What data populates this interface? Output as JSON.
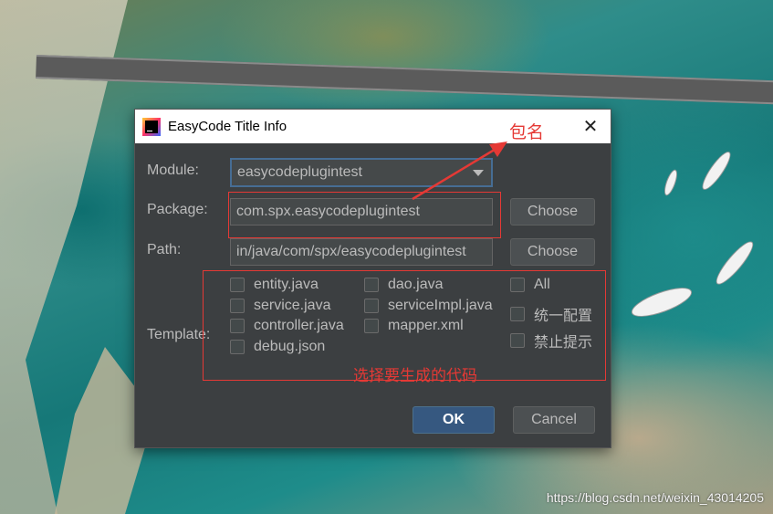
{
  "background": {
    "watermark": "https://blog.csdn.net/weixin_43014205"
  },
  "dialog": {
    "title": "EasyCode Title Info",
    "app_icon": "intellij-icon",
    "close_icon": "close-icon",
    "module": {
      "label": "Module:",
      "value": "easycodeplugintest"
    },
    "package": {
      "label": "Package:",
      "value": "com.spx.easycodeplugintest",
      "choose_label": "Choose"
    },
    "path": {
      "label": "Path:",
      "value": "in/java/com/spx/easycodeplugintest",
      "choose_label": "Choose"
    },
    "template": {
      "label": "Template:",
      "items": [
        {
          "label": "entity.java",
          "checked": false
        },
        {
          "label": "service.java",
          "checked": false
        },
        {
          "label": "controller.java",
          "checked": false
        },
        {
          "label": "debug.json",
          "checked": false
        },
        {
          "label": "dao.java",
          "checked": false
        },
        {
          "label": "serviceImpl.java",
          "checked": false
        },
        {
          "label": "mapper.xml",
          "checked": false
        }
      ],
      "options": [
        {
          "label": "All",
          "checked": false
        },
        {
          "label": "统一配置",
          "checked": false
        },
        {
          "label": "禁止提示",
          "checked": false
        }
      ]
    },
    "ok_label": "OK",
    "cancel_label": "Cancel"
  },
  "annotations": {
    "package_note": "包名",
    "template_note": "选择要生成的代码",
    "color": "#e53935"
  }
}
